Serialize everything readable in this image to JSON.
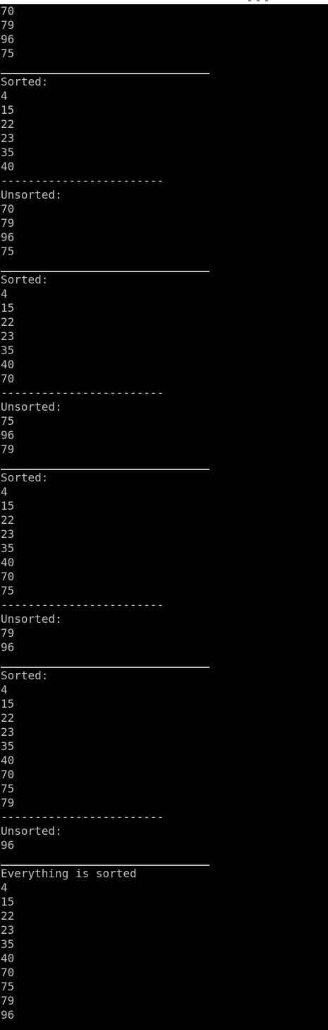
{
  "colors": {
    "background": "#000000",
    "text": "#c0c0c0"
  },
  "console": {
    "lines": [
      "70",
      "79",
      "96",
      "75",
      "",
      "Sorted:",
      "4",
      "15",
      "22",
      "23",
      "35",
      "40",
      "------------------------",
      "Unsorted:",
      "70",
      "79",
      "96",
      "75",
      "",
      "Sorted:",
      "4",
      "15",
      "22",
      "23",
      "35",
      "40",
      "70",
      "------------------------",
      "Unsorted:",
      "75",
      "96",
      "79",
      "",
      "Sorted:",
      "4",
      "15",
      "22",
      "23",
      "35",
      "40",
      "70",
      "75",
      "------------------------",
      "Unsorted:",
      "79",
      "96",
      "",
      "Sorted:",
      "4",
      "15",
      "22",
      "23",
      "35",
      "40",
      "70",
      "75",
      "79",
      "------------------------",
      "Unsorted:",
      "96",
      "",
      "Everything is sorted",
      "4",
      "15",
      "22",
      "23",
      "35",
      "40",
      "70",
      "75",
      "79",
      "96"
    ]
  }
}
